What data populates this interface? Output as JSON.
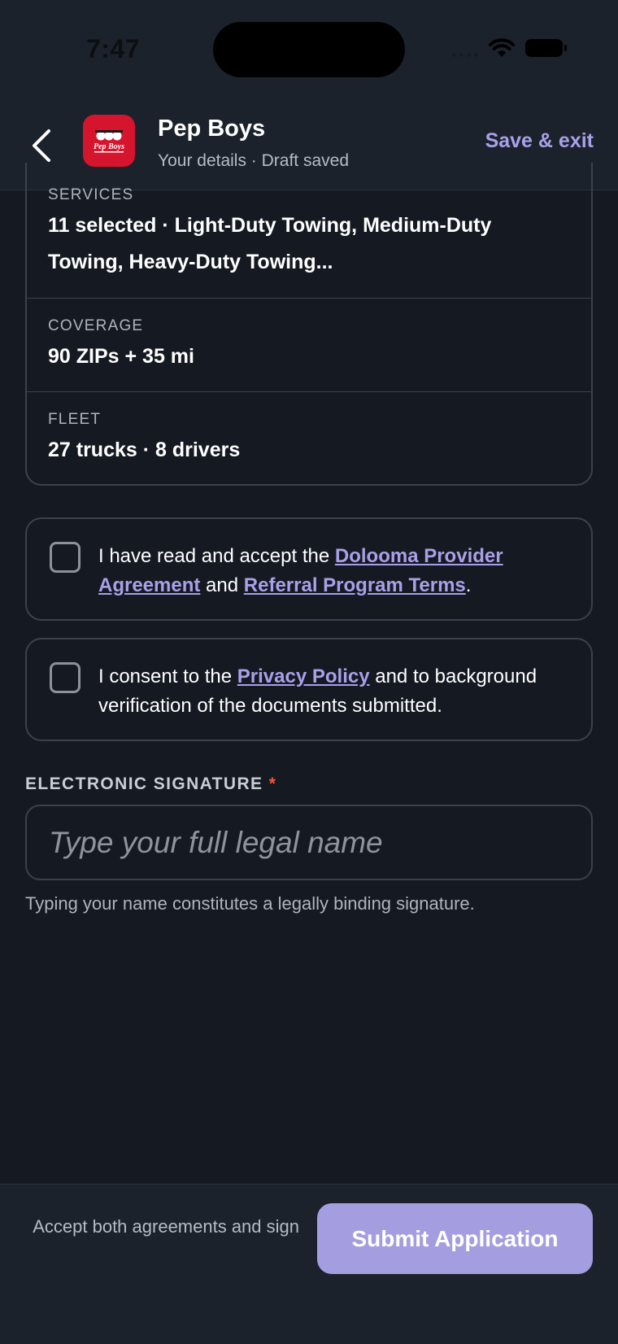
{
  "status_bar": {
    "time": "7:47"
  },
  "header": {
    "title": "Pep Boys",
    "subtitle": "Your details · Draft saved",
    "save_exit_label": "Save & exit",
    "logo_text": "Pep Boys",
    "logo_color": "#d5142e"
  },
  "summary": {
    "services": {
      "label": "SERVICES",
      "value": "11 selected · Light-Duty Towing, Medium-Duty Towing, Heavy-Duty Towing..."
    },
    "coverage": {
      "label": "COVERAGE",
      "value": "90 ZIPs + 35 mi"
    },
    "fleet": {
      "label": "FLEET",
      "value": "27 trucks · 8 drivers"
    }
  },
  "agreements": {
    "provider": {
      "prefix": "I have read and accept the ",
      "link1": "Dolooma Provider Agreement",
      "middle": " and ",
      "link2": "Referral Program Terms",
      "suffix": "."
    },
    "privacy": {
      "prefix": "I consent to the ",
      "link1": "Privacy Policy",
      "suffix": " and to background verification of the documents submitted."
    }
  },
  "signature": {
    "label": "ELECTRONIC SIGNATURE",
    "required_mark": "*",
    "placeholder": "Type your full legal name",
    "value": "",
    "help": "Typing your name constitutes a legally binding signature."
  },
  "footer": {
    "hint": "Accept both agreements and sign",
    "submit_label": "Submit Application"
  },
  "colors": {
    "accent": "#a9a0e8",
    "required": "#ef5a3c",
    "background": "#151922"
  }
}
